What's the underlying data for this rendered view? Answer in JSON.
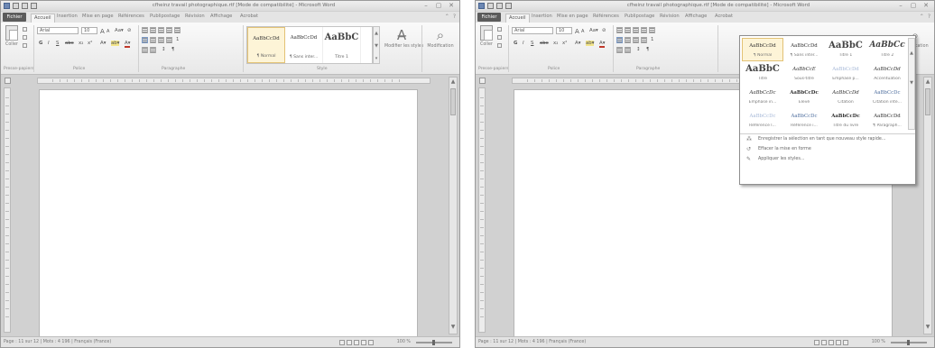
{
  "window": {
    "title": "cfheinz travail photographique.rtf [Mode de compatibilité] - Microsoft Word",
    "controls": [
      "–",
      "▢",
      "✕"
    ]
  },
  "tabs": [
    "Fichier",
    "Accueil",
    "Insertion",
    "Mise en page",
    "Références",
    "Publipostage",
    "Révision",
    "Affichage",
    "Acrobat"
  ],
  "ribbon": {
    "paste_label": "Coller",
    "font_name": "Arial",
    "font_size": "10",
    "grow_font": "A",
    "shrink_font": "A",
    "bold": "G",
    "italic": "I",
    "underline": "S",
    "strikethrough": "abc",
    "subscript": "x₂",
    "superscript": "x²",
    "line_spacing": "1",
    "sort": "↕",
    "pilcrow": "¶",
    "groups": {
      "clipboard": "Presse-papiers",
      "font": "Police",
      "paragraph": "Paragraphe",
      "styles": "Style"
    },
    "styles": [
      {
        "preview": "AaBbCcDd",
        "name": "¶ Normal"
      },
      {
        "preview": "AaBbCcDd",
        "name": "¶ Sans inter..."
      },
      {
        "preview": "AaBbC",
        "name": "Titre 1"
      }
    ],
    "change_styles": "Modifier les styles",
    "editing": "Modification"
  },
  "statusbar": {
    "page": "Page : 11 sur 12",
    "words": "Mots : 4 196",
    "language": "Français (France)",
    "zoom": "100 %"
  },
  "style_dropdown": {
    "tiles": [
      {
        "preview": "AaBbCcDd",
        "name": "¶ Normal",
        "look": "sel"
      },
      {
        "preview": "AaBbCcDd",
        "name": "¶ Sans inter...",
        "look": ""
      },
      {
        "preview": "AaBbC",
        "name": "Titre 1",
        "look": "huge"
      },
      {
        "preview": "AaBbCc",
        "name": "Titre 2",
        "look": "biggish"
      },
      {
        "preview": "AaBbC",
        "name": "Titre",
        "look": "huge"
      },
      {
        "preview": "AaBbCcE",
        "name": "Sous-titre",
        "look": "ital"
      },
      {
        "preview": "AaBbCcDd",
        "name": "Emphase p...",
        "look": "faint"
      },
      {
        "preview": "AaBbCcDd",
        "name": "Accentuation",
        "look": "ital"
      },
      {
        "preview": "AaBbCcDc",
        "name": "Emphase in...",
        "look": "ital"
      },
      {
        "preview": "AaBbCcDc",
        "name": "Élevé",
        "look": "bold"
      },
      {
        "preview": "AaBbCcDd",
        "name": "Citation",
        "look": "ital"
      },
      {
        "preview": "AaBbCcDc",
        "name": "Citation inte...",
        "look": "blue"
      },
      {
        "preview": "AaBbCcDc",
        "name": "Référence l...",
        "look": "faint"
      },
      {
        "preview": "AaBbCcDc",
        "name": "Référence i...",
        "look": "blue"
      },
      {
        "preview": "AaBbCcDc",
        "name": "Titre du livre",
        "look": "bold"
      },
      {
        "preview": "AaBbCcDd",
        "name": "¶ Paragraph...",
        "look": ""
      }
    ],
    "commands": [
      {
        "icon": "⁂",
        "label": "Enregistrer la sélection en tant que nouveau style rapide..."
      },
      {
        "icon": "↺",
        "label": "Effacer la mise en forme"
      },
      {
        "icon": "✎",
        "label": "Appliquer les styles..."
      }
    ]
  }
}
